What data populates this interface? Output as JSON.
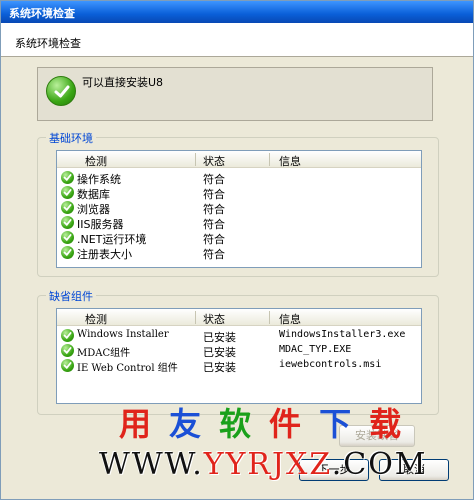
{
  "window": {
    "title": "系统环境检查"
  },
  "subheader": {
    "title": "系统环境检查"
  },
  "status": {
    "message": "可以直接安装U8"
  },
  "basic": {
    "legend": "基础环境",
    "columns": [
      "检测",
      "状态",
      "信息"
    ],
    "rows": [
      {
        "name": "操作系统",
        "status": "符合",
        "info": ""
      },
      {
        "name": "数据库",
        "status": "符合",
        "info": ""
      },
      {
        "name": "浏览器",
        "status": "符合",
        "info": ""
      },
      {
        "name": "IIS服务器",
        "status": "符合",
        "info": ""
      },
      {
        "name": ".NET运行环境",
        "status": "符合",
        "info": ""
      },
      {
        "name": "注册表大小",
        "status": "符合",
        "info": ""
      }
    ]
  },
  "components": {
    "legend": "缺省组件",
    "columns": [
      "检测",
      "状态",
      "信息"
    ],
    "rows": [
      {
        "name": "Windows Installer",
        "status": "已安装",
        "info": "WindowsInstaller3.exe"
      },
      {
        "name": "MDAC组件",
        "status": "已安装",
        "info": "MDAC_TYP.EXE"
      },
      {
        "name": "IE Web Control 组件",
        "status": "已安装",
        "info": "iewebcontrols.msi"
      }
    ]
  },
  "buttons": {
    "install_label": "安装缺省",
    "next_label": "下一步",
    "cancel_label": "取消"
  },
  "watermark": {
    "chars": [
      "用",
      "友",
      "软",
      "件",
      "下",
      "载"
    ],
    "colors": [
      "#e0241b",
      "#1b50d6",
      "#1aa01a",
      "#e0241b",
      "#1b50d6",
      "#e0241b"
    ],
    "url_prefix": "WWW.",
    "url_red": "YYRJXZ",
    "url_suffix": ".COM"
  }
}
